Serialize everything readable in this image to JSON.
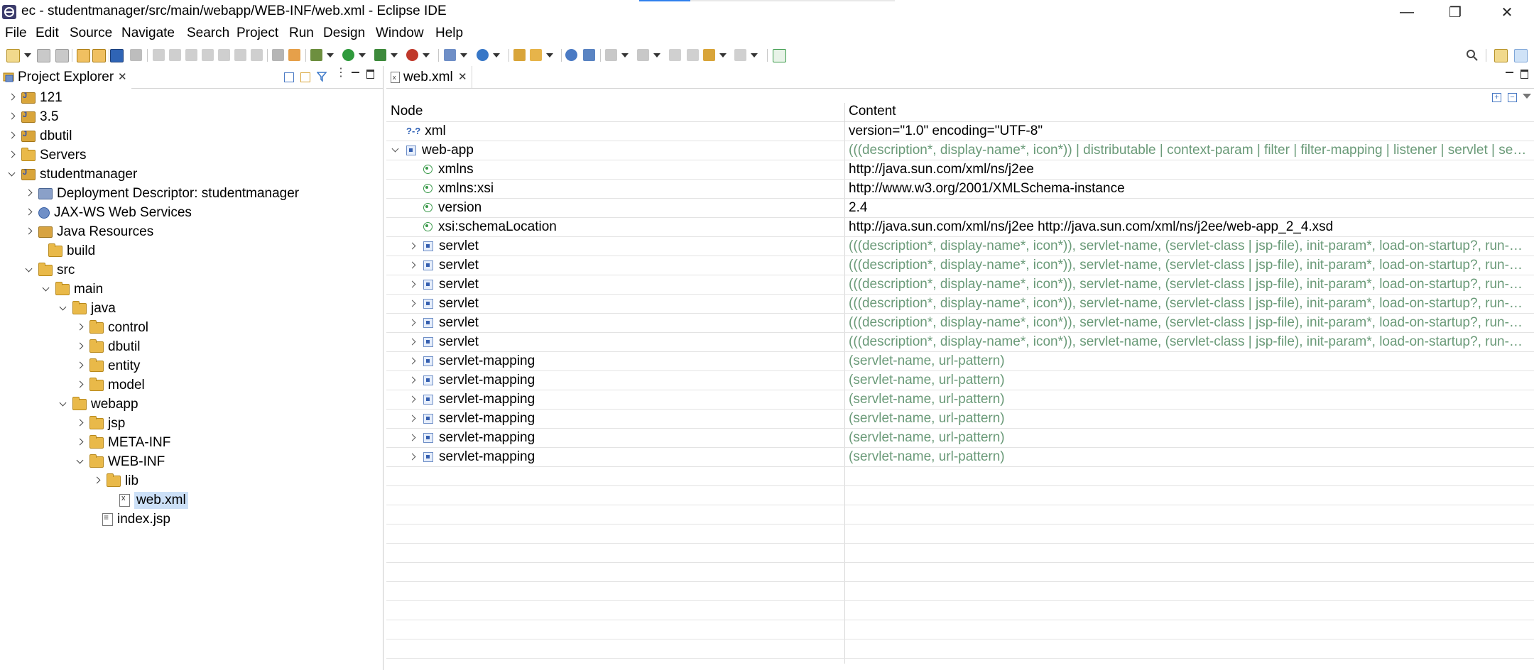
{
  "window": {
    "title": "ec - studentmanager/src/main/webapp/WEB-INF/web.xml - Eclipse IDE",
    "minimize_glyph": "—",
    "maximize_glyph": "❐",
    "close_glyph": "✕",
    "progress_fraction": 0.2
  },
  "menu": {
    "items": [
      {
        "label": "File"
      },
      {
        "label": "Edit"
      },
      {
        "label": "Source"
      },
      {
        "label": "Navigate"
      },
      {
        "label": "Search"
      },
      {
        "label": "Project"
      },
      {
        "label": "Run"
      },
      {
        "label": "Design"
      },
      {
        "label": "Window"
      },
      {
        "label": "Help"
      }
    ]
  },
  "project_explorer": {
    "title": "Project Explorer",
    "close_glyph": "✕",
    "tree": [
      {
        "label": "121",
        "icon": "project-icon",
        "twisty": "closed"
      },
      {
        "label": "3.5",
        "icon": "project-icon",
        "twisty": "closed"
      },
      {
        "label": "dbutil",
        "icon": "project-icon",
        "twisty": "closed"
      },
      {
        "label": "Servers",
        "icon": "folder-icon",
        "twisty": "closed"
      },
      {
        "label": "studentmanager",
        "icon": "project-icon",
        "twisty": "open"
      },
      {
        "label": "Deployment Descriptor: studentmanager",
        "icon": "deployment-descriptor-icon",
        "twisty": "closed"
      },
      {
        "label": "JAX-WS Web Services",
        "icon": "web-services-icon",
        "twisty": "closed"
      },
      {
        "label": "Java Resources",
        "icon": "java-resources-icon",
        "twisty": "closed"
      },
      {
        "label": "build",
        "icon": "folder-icon",
        "twisty": "none"
      },
      {
        "label": "src",
        "icon": "folder-icon",
        "twisty": "open"
      },
      {
        "label": "main",
        "icon": "folder-icon",
        "twisty": "open"
      },
      {
        "label": "java",
        "icon": "folder-icon",
        "twisty": "open"
      },
      {
        "label": "control",
        "icon": "package-folder-icon",
        "twisty": "closed"
      },
      {
        "label": "dbutil",
        "icon": "package-folder-icon",
        "twisty": "closed"
      },
      {
        "label": "entity",
        "icon": "package-folder-icon",
        "twisty": "closed"
      },
      {
        "label": "model",
        "icon": "package-folder-icon",
        "twisty": "closed"
      },
      {
        "label": "webapp",
        "icon": "folder-icon",
        "twisty": "open"
      },
      {
        "label": "jsp",
        "icon": "folder-icon",
        "twisty": "closed"
      },
      {
        "label": "META-INF",
        "icon": "folder-icon",
        "twisty": "closed"
      },
      {
        "label": "WEB-INF",
        "icon": "folder-icon",
        "twisty": "open"
      },
      {
        "label": "lib",
        "icon": "folder-icon",
        "twisty": "closed"
      },
      {
        "label": "web.xml",
        "icon": "xml-file-icon",
        "twisty": "none",
        "selected": true
      },
      {
        "label": "index.jsp",
        "icon": "jsp-file-icon",
        "twisty": "none"
      }
    ]
  },
  "editor": {
    "tab_label": "web.xml",
    "tab_close_glyph": "✕",
    "headers": {
      "node": "Node",
      "content": "Content"
    },
    "rows": [
      {
        "node": "xml",
        "content": "version=\"1.0\" encoding=\"UTF-8\"",
        "icon": "processing-instruction-icon",
        "twisty": "none",
        "gray": false
      },
      {
        "node": "web-app",
        "content": "(((description*, display-name*, icon*)) | distributable | context-param | filter | filter-mapping | listener | servlet | servlet-mapping | session-config | mime-mapping | welcome-file-list | error-page | jsp-config | security-constraint | login-config | security-role | env-entry | ejb-ref | ejb-local-ref | service-ref | resource-ref | resource-env-ref | message-destination-ref | message-destination | locale-encoding-mapping-list)*",
        "icon": "element-icon",
        "twisty": "open",
        "gray": true
      },
      {
        "node": "xmlns",
        "content": "http://java.sun.com/xml/ns/j2ee",
        "icon": "attribute-icon",
        "twisty": "none",
        "gray": false
      },
      {
        "node": "xmlns:xsi",
        "content": "http://www.w3.org/2001/XMLSchema-instance",
        "icon": "attribute-icon",
        "twisty": "none",
        "gray": false
      },
      {
        "node": "version",
        "content": "2.4",
        "icon": "attribute-icon",
        "twisty": "none",
        "gray": false
      },
      {
        "node": "xsi:schemaLocation",
        "content": "http://java.sun.com/xml/ns/j2ee   http://java.sun.com/xml/ns/j2ee/web-app_2_4.xsd",
        "icon": "attribute-icon",
        "twisty": "none",
        "gray": false
      },
      {
        "node": "servlet",
        "content": "(((description*, display-name*, icon*)), servlet-name, (servlet-class | jsp-file), init-param*, load-on-startup?, run-as?, security-role-ref*)",
        "icon": "element-icon",
        "twisty": "closed",
        "gray": true
      },
      {
        "node": "servlet",
        "content": "(((description*, display-name*, icon*)), servlet-name, (servlet-class | jsp-file), init-param*, load-on-startup?, run-as?, security-role-ref*)",
        "icon": "element-icon",
        "twisty": "closed",
        "gray": true
      },
      {
        "node": "servlet",
        "content": "(((description*, display-name*, icon*)), servlet-name, (servlet-class | jsp-file), init-param*, load-on-startup?, run-as?, security-role-ref*)",
        "icon": "element-icon",
        "twisty": "closed",
        "gray": true
      },
      {
        "node": "servlet",
        "content": "(((description*, display-name*, icon*)), servlet-name, (servlet-class | jsp-file), init-param*, load-on-startup?, run-as?, security-role-ref*)",
        "icon": "element-icon",
        "twisty": "closed",
        "gray": true
      },
      {
        "node": "servlet",
        "content": "(((description*, display-name*, icon*)), servlet-name, (servlet-class | jsp-file), init-param*, load-on-startup?, run-as?, security-role-ref*)",
        "icon": "element-icon",
        "twisty": "closed",
        "gray": true
      },
      {
        "node": "servlet",
        "content": "(((description*, display-name*, icon*)), servlet-name, (servlet-class | jsp-file), init-param*, load-on-startup?, run-as?, security-role-ref*)",
        "icon": "element-icon",
        "twisty": "closed",
        "gray": true
      },
      {
        "node": "servlet-mapping",
        "content": "(servlet-name, url-pattern)",
        "icon": "element-icon",
        "twisty": "closed",
        "gray": true
      },
      {
        "node": "servlet-mapping",
        "content": "(servlet-name, url-pattern)",
        "icon": "element-icon",
        "twisty": "closed",
        "gray": true
      },
      {
        "node": "servlet-mapping",
        "content": "(servlet-name, url-pattern)",
        "icon": "element-icon",
        "twisty": "closed",
        "gray": true
      },
      {
        "node": "servlet-mapping",
        "content": "(servlet-name, url-pattern)",
        "icon": "element-icon",
        "twisty": "closed",
        "gray": true
      },
      {
        "node": "servlet-mapping",
        "content": "(servlet-name, url-pattern)",
        "icon": "element-icon",
        "twisty": "closed",
        "gray": true
      },
      {
        "node": "servlet-mapping",
        "content": "(servlet-name, url-pattern)",
        "icon": "element-icon",
        "twisty": "closed",
        "gray": true
      }
    ],
    "empty_rows": 10
  },
  "colors": {
    "selection": "#cce0f7",
    "grammar_text": "#6a9a78",
    "progress": "#2f80ed"
  }
}
